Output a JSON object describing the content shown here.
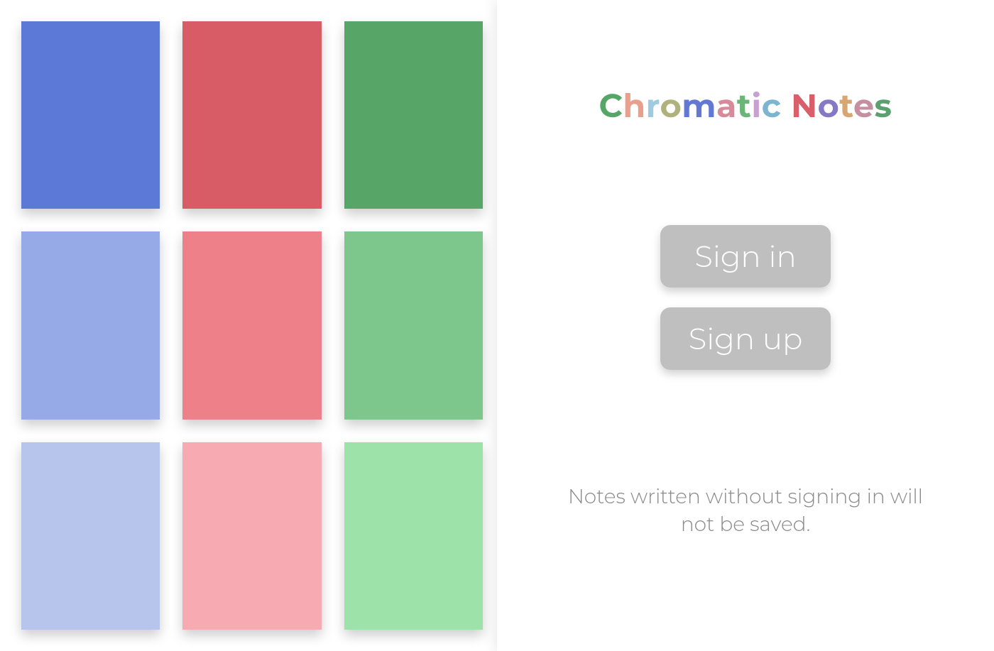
{
  "app": {
    "title_chars": [
      {
        "char": "C",
        "color": "#56a668"
      },
      {
        "char": "h",
        "color": "#e8a08c"
      },
      {
        "char": "r",
        "color": "#9fcbe0"
      },
      {
        "char": "o",
        "color": "#b0b27e"
      },
      {
        "char": "m",
        "color": "#6378d2"
      },
      {
        "char": "a",
        "color": "#d78b9a"
      },
      {
        "char": "t",
        "color": "#6bb578"
      },
      {
        "char": "i",
        "color": "#c9a0d2"
      },
      {
        "char": "c",
        "color": "#7cb5cf"
      },
      {
        "char": " ",
        "color": "#000000"
      },
      {
        "char": "N",
        "color": "#d95f6b"
      },
      {
        "char": "o",
        "color": "#8578c4"
      },
      {
        "char": "t",
        "color": "#d8a672"
      },
      {
        "char": "e",
        "color": "#c58fa1"
      },
      {
        "char": "s",
        "color": "#5ba06f"
      }
    ]
  },
  "auth": {
    "sign_in_label": "Sign in",
    "sign_up_label": "Sign up"
  },
  "disclaimer": "Notes written without signing in will not be saved.",
  "palette": {
    "tiles": [
      {
        "name": "blue-dark",
        "color": "#5d79d8"
      },
      {
        "name": "red-dark",
        "color": "#d85c66"
      },
      {
        "name": "green-dark",
        "color": "#57a667"
      },
      {
        "name": "blue-mid",
        "color": "#95aae6"
      },
      {
        "name": "red-mid",
        "color": "#ed8088"
      },
      {
        "name": "green-mid",
        "color": "#7dc78d"
      },
      {
        "name": "blue-light",
        "color": "#b7c4ec"
      },
      {
        "name": "red-light",
        "color": "#f7aab2"
      },
      {
        "name": "green-light",
        "color": "#9de2a9"
      }
    ]
  }
}
